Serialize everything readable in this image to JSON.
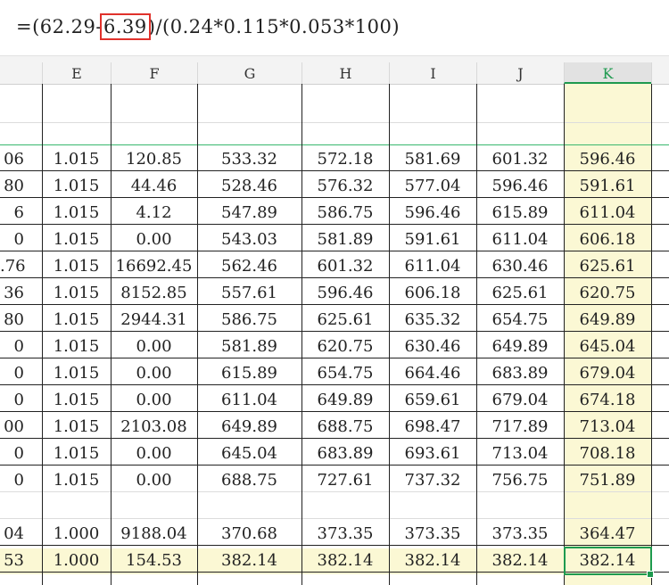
{
  "formula_bar": {
    "prefix": "=(62.29-",
    "highlighted": "6.39",
    "suffix": ")/(0.24*0.115*0.053*100)"
  },
  "column_headers": [
    "E",
    "F",
    "G",
    "H",
    "I",
    "J",
    "K"
  ],
  "selected_column": "K",
  "rows": [
    {
      "a": "06",
      "e": "1.015",
      "f": "120.85",
      "g": "533.32",
      "h": "572.18",
      "i": "581.69",
      "j": "601.32",
      "k": "596.46"
    },
    {
      "a": "80",
      "e": "1.015",
      "f": "44.46",
      "g": "528.46",
      "h": "576.32",
      "i": "577.04",
      "j": "596.46",
      "k": "591.61"
    },
    {
      "a": "6",
      "e": "1.015",
      "f": "4.12",
      "g": "547.89",
      "h": "586.75",
      "i": "596.46",
      "j": "615.89",
      "k": "611.04"
    },
    {
      "a": "0",
      "e": "1.015",
      "f": "0.00",
      "g": "543.03",
      "h": "581.89",
      "i": "591.61",
      "j": "611.04",
      "k": "606.18"
    },
    {
      "a": ".76",
      "e": "1.015",
      "f": "16692.45",
      "g": "562.46",
      "h": "601.32",
      "i": "611.04",
      "j": "630.46",
      "k": "625.61"
    },
    {
      "a": "36",
      "e": "1.015",
      "f": "8152.85",
      "g": "557.61",
      "h": "596.46",
      "i": "606.18",
      "j": "625.61",
      "k": "620.75"
    },
    {
      "a": "80",
      "e": "1.015",
      "f": "2944.31",
      "g": "586.75",
      "h": "625.61",
      "i": "635.32",
      "j": "654.75",
      "k": "649.89"
    },
    {
      "a": "0",
      "e": "1.015",
      "f": "0.00",
      "g": "581.89",
      "h": "620.75",
      "i": "630.46",
      "j": "649.89",
      "k": "645.04"
    },
    {
      "a": "0",
      "e": "1.015",
      "f": "0.00",
      "g": "615.89",
      "h": "654.75",
      "i": "664.46",
      "j": "683.89",
      "k": "679.04"
    },
    {
      "a": "0",
      "e": "1.015",
      "f": "0.00",
      "g": "611.04",
      "h": "649.89",
      "i": "659.61",
      "j": "679.04",
      "k": "674.18"
    },
    {
      "a": "00",
      "e": "1.015",
      "f": "2103.08",
      "g": "649.89",
      "h": "688.75",
      "i": "698.47",
      "j": "717.89",
      "k": "713.04"
    },
    {
      "a": "0",
      "e": "1.015",
      "f": "0.00",
      "g": "645.04",
      "h": "683.89",
      "i": "693.61",
      "j": "713.04",
      "k": "708.18"
    },
    {
      "a": "0",
      "e": "1.015",
      "f": "0.00",
      "g": "688.75",
      "h": "727.61",
      "i": "737.32",
      "j": "756.75",
      "k": "751.89"
    },
    {
      "a": "",
      "e": "",
      "f": "",
      "g": "",
      "h": "",
      "i": "",
      "j": "",
      "k": ""
    },
    {
      "a": "04",
      "e": "1.000",
      "f": "9188.04",
      "g": "370.68",
      "h": "373.35",
      "i": "373.35",
      "j": "373.35",
      "k": "364.47"
    },
    {
      "a": "53",
      "e": "1.000",
      "f": "154.53",
      "g": "382.14",
      "h": "382.14",
      "i": "382.14",
      "j": "382.14",
      "k": "382.14"
    }
  ],
  "colors": {
    "selection": "#1e9a4f",
    "highlight_box": "#e0312b",
    "selected_column_fill": "#fbf8d4"
  }
}
